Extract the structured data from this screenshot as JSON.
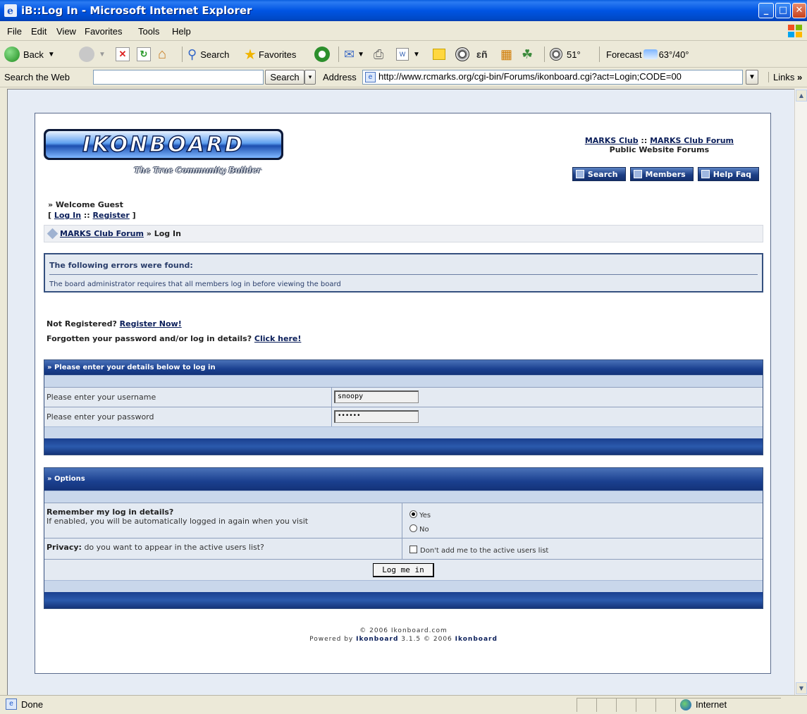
{
  "window": {
    "title": "iB::Log In - Microsoft Internet Explorer"
  },
  "menu": [
    "File",
    "Edit",
    "View",
    "Favorites",
    "Tools",
    "Help"
  ],
  "toolbar": {
    "back": "Back",
    "search": "Search",
    "favorites": "Favorites",
    "weather_temp": "51°",
    "forecast_label": "Forecast",
    "forecast_temp": "63°/40°"
  },
  "addressbar": {
    "search_web_label": "Search the Web",
    "search_button": "Search",
    "address_label": "Address",
    "url": "http://www.rcmarks.org/cgi-bin/Forums/ikonboard.cgi?act=Login;CODE=00",
    "links": "Links"
  },
  "header": {
    "site_link": "MARKS Club",
    "separator": " :: ",
    "forum_link": "MARKS Club Forum",
    "subtitle": "Public Website Forums",
    "tagline": "The True Community Builder",
    "nav_buttons": [
      "Search",
      "Members",
      "Help Faq"
    ]
  },
  "welcome": {
    "greeting": "» Welcome Guest",
    "open_bracket": "[ ",
    "login": "Log In",
    "sep": " :: ",
    "register": "Register",
    "close_bracket": " ]"
  },
  "breadcrumb": {
    "forum": "MARKS Club Forum",
    "current": " » Log In"
  },
  "errors": {
    "heading": "The following errors were found:",
    "message": "The board administrator requires that all members log in before viewing the board"
  },
  "register_info": {
    "not_registered": "Not Registered? ",
    "register_now": "Register Now!",
    "forgotten": "Forgotten your password and/or log in details? ",
    "click_here": "Click here!"
  },
  "login_panel": {
    "heading": "» Please enter your details below to log in",
    "username_label": "Please enter your username",
    "username_value": "snoopy",
    "password_label": "Please enter your password",
    "password_value": "••••••"
  },
  "options_panel": {
    "heading": "» Options",
    "remember_title": "Remember my log in details?",
    "remember_desc": "If enabled, you will be automatically logged in again when you visit",
    "yes": "Yes",
    "no": "No",
    "privacy_title": "Privacy:",
    "privacy_desc": " do you want to appear in the active users list?",
    "privacy_check": "Don't add me to the active users list",
    "submit": "Log me in"
  },
  "footer": {
    "copyright": "© 2006 Ikonboard.com",
    "powered_prefix": "Powered by ",
    "powered_link": "Ikonboard",
    "version": " 3.1.5 © 2006 ",
    "powered_link2": "Ikonboard"
  },
  "statusbar": {
    "status": "Done",
    "zone": "Internet"
  },
  "colors": {
    "titlebar": "#0054e3",
    "panel_header": "#1a3f8f",
    "page_bg": "#e6ecf5"
  }
}
